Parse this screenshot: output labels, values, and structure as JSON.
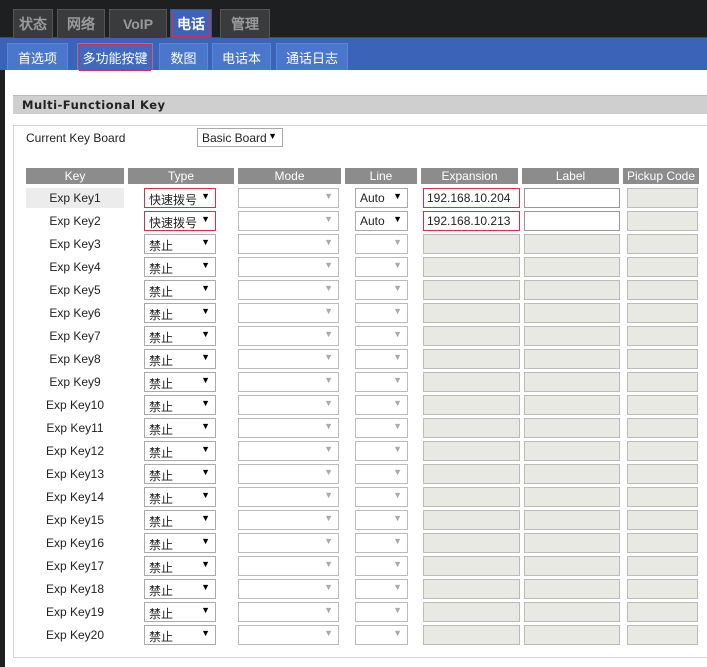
{
  "top_tabs": [
    {
      "label": "状态"
    },
    {
      "label": "网络"
    },
    {
      "label": "VoIP"
    },
    {
      "label": "电话",
      "active": true
    },
    {
      "label": "管理"
    }
  ],
  "sub_tabs": [
    {
      "label": "首选项"
    },
    {
      "label": "多功能按键",
      "active": true
    },
    {
      "label": "数图"
    },
    {
      "label": "电话本"
    },
    {
      "label": "通话日志"
    }
  ],
  "section_title": "Multi-Functional Key",
  "keyboard": {
    "label": "Current Key Board",
    "value": "Basic Board"
  },
  "columns": [
    "Key",
    "Type",
    "Mode",
    "Line",
    "Expansion",
    "Label",
    "Pickup Code"
  ],
  "rows": [
    {
      "key": "Exp Key1",
      "type": "快速拨号",
      "mode": "",
      "line": "Auto",
      "expansion": "192.168.10.204",
      "label": "",
      "pickup": ""
    },
    {
      "key": "Exp Key2",
      "type": "快速拨号",
      "mode": "",
      "line": "Auto",
      "expansion": "192.168.10.213",
      "label": "",
      "pickup": ""
    },
    {
      "key": "Exp Key3",
      "type": "禁止"
    },
    {
      "key": "Exp Key4",
      "type": "禁止"
    },
    {
      "key": "Exp Key5",
      "type": "禁止"
    },
    {
      "key": "Exp Key6",
      "type": "禁止"
    },
    {
      "key": "Exp Key7",
      "type": "禁止"
    },
    {
      "key": "Exp Key8",
      "type": "禁止"
    },
    {
      "key": "Exp Key9",
      "type": "禁止"
    },
    {
      "key": "Exp Key10",
      "type": "禁止"
    },
    {
      "key": "Exp Key11",
      "type": "禁止"
    },
    {
      "key": "Exp Key12",
      "type": "禁止"
    },
    {
      "key": "Exp Key13",
      "type": "禁止"
    },
    {
      "key": "Exp Key14",
      "type": "禁止"
    },
    {
      "key": "Exp Key15",
      "type": "禁止"
    },
    {
      "key": "Exp Key16",
      "type": "禁止"
    },
    {
      "key": "Exp Key17",
      "type": "禁止"
    },
    {
      "key": "Exp Key18",
      "type": "禁止"
    },
    {
      "key": "Exp Key19",
      "type": "禁止"
    },
    {
      "key": "Exp Key20",
      "type": "禁止"
    }
  ],
  "colors": {
    "accent": "#3b63b8",
    "highlight": "#d0324a"
  }
}
